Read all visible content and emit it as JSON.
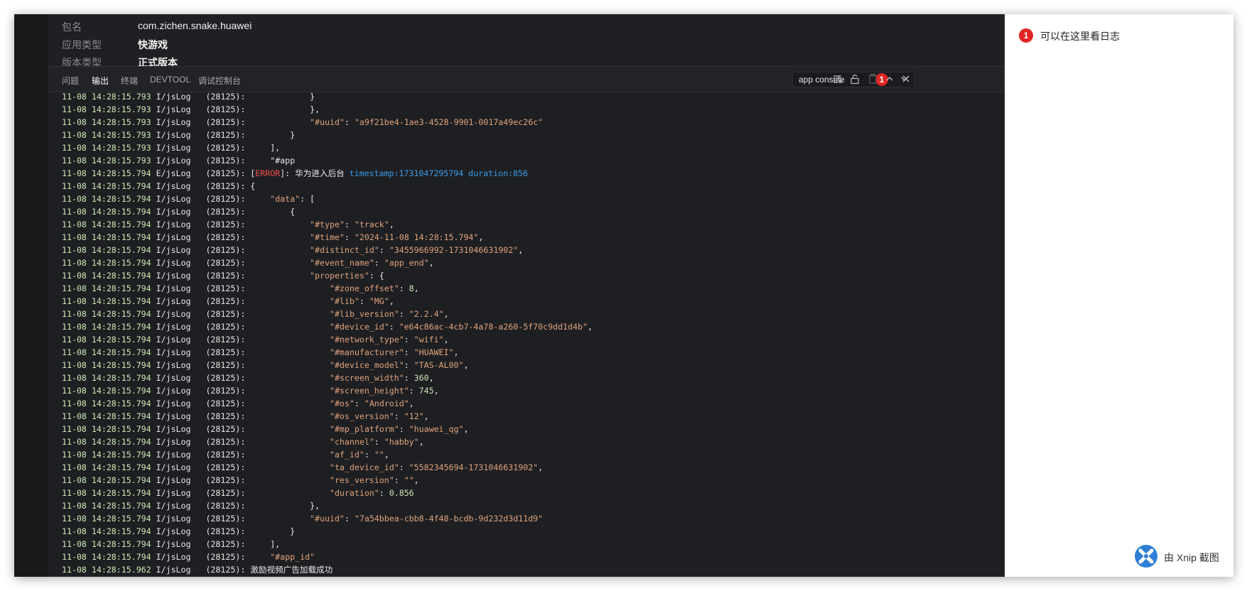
{
  "app_info": {
    "rows": [
      {
        "label": "包名",
        "value": "com.zichen.snake.huawei",
        "bold": false
      },
      {
        "label": "应用类型",
        "value": "快游戏",
        "bold": true
      },
      {
        "label": "版本类型",
        "value": "正式版本",
        "bold": true
      }
    ]
  },
  "panel": {
    "tabs": [
      {
        "label": "问题",
        "active": false
      },
      {
        "label": "输出",
        "active": true
      },
      {
        "label": "终端",
        "active": false
      },
      {
        "label": "DEVTOOL",
        "active": false
      },
      {
        "label": "调试控制台",
        "active": false
      }
    ],
    "filter": {
      "value": "app console",
      "badge": "1"
    },
    "icons": [
      "chevron-down-icon",
      "clear-output-icon",
      "lock-icon",
      "copy-icon",
      "chevron-up-icon",
      "close-icon"
    ]
  },
  "log": {
    "lines": [
      {
        "ts": "11-08 14:28:15.793",
        "tag": "I/jsLog",
        "pid": "(28125):",
        "indent": 0,
        "segs": [
          [
            "p",
            "            }"
          ]
        ]
      },
      {
        "ts": "11-08 14:28:15.793",
        "tag": "I/jsLog",
        "pid": "(28125):",
        "indent": 0,
        "segs": [
          [
            "p",
            "            },"
          ]
        ]
      },
      {
        "ts": "11-08 14:28:15.793",
        "tag": "I/jsLog",
        "pid": "(28125):",
        "indent": 0,
        "segs": [
          [
            "p",
            "            "
          ],
          [
            "k",
            "\"#uuid\""
          ],
          [
            "p",
            ": "
          ],
          [
            "s",
            "\"a9f21be4-1ae3-4528-9901-0017a49ec26c\""
          ]
        ]
      },
      {
        "ts": "11-08 14:28:15.793",
        "tag": "I/jsLog",
        "pid": "(28125):",
        "indent": 0,
        "segs": [
          [
            "p",
            "        }"
          ]
        ]
      },
      {
        "ts": "11-08 14:28:15.793",
        "tag": "I/jsLog",
        "pid": "(28125):",
        "indent": 0,
        "segs": [
          [
            "p",
            "    ],"
          ]
        ]
      },
      {
        "ts": "11-08 14:28:15.793",
        "tag": "I/jsLog",
        "pid": "(28125):",
        "indent": 0,
        "segs": [
          [
            "p",
            "    \"#app"
          ]
        ]
      },
      {
        "ts": "11-08 14:28:15.794",
        "tag": "E/jsLog",
        "pid": "(28125):",
        "indent": 0,
        "segs": [
          [
            "p",
            "["
          ],
          [
            "err",
            "ERROR"
          ],
          [
            "p",
            "]: 华为进入后台 "
          ],
          [
            "meta",
            "timestamp:1731047295794 duration:856"
          ]
        ]
      },
      {
        "ts": "11-08 14:28:15.794",
        "tag": "I/jsLog",
        "pid": "(28125):",
        "indent": 0,
        "segs": [
          [
            "p",
            "{"
          ]
        ]
      },
      {
        "ts": "11-08 14:28:15.794",
        "tag": "I/jsLog",
        "pid": "(28125):",
        "indent": 0,
        "segs": [
          [
            "p",
            "    "
          ],
          [
            "k",
            "\"data\""
          ],
          [
            "p",
            ": ["
          ]
        ]
      },
      {
        "ts": "11-08 14:28:15.794",
        "tag": "I/jsLog",
        "pid": "(28125):",
        "indent": 0,
        "segs": [
          [
            "p",
            "        {"
          ]
        ]
      },
      {
        "ts": "11-08 14:28:15.794",
        "tag": "I/jsLog",
        "pid": "(28125):",
        "indent": 0,
        "segs": [
          [
            "p",
            "            "
          ],
          [
            "k",
            "\"#type\""
          ],
          [
            "p",
            ": "
          ],
          [
            "s",
            "\"track\""
          ],
          [
            "p",
            ","
          ]
        ]
      },
      {
        "ts": "11-08 14:28:15.794",
        "tag": "I/jsLog",
        "pid": "(28125):",
        "indent": 0,
        "segs": [
          [
            "p",
            "            "
          ],
          [
            "k",
            "\"#time\""
          ],
          [
            "p",
            ": "
          ],
          [
            "s",
            "\"2024-11-08 14:28:15.794\""
          ],
          [
            "p",
            ","
          ]
        ]
      },
      {
        "ts": "11-08 14:28:15.794",
        "tag": "I/jsLog",
        "pid": "(28125):",
        "indent": 0,
        "segs": [
          [
            "p",
            "            "
          ],
          [
            "k",
            "\"#distinct_id\""
          ],
          [
            "p",
            ": "
          ],
          [
            "s",
            "\"3455966992-1731046631902\""
          ],
          [
            "p",
            ","
          ]
        ]
      },
      {
        "ts": "11-08 14:28:15.794",
        "tag": "I/jsLog",
        "pid": "(28125):",
        "indent": 0,
        "segs": [
          [
            "p",
            "            "
          ],
          [
            "k",
            "\"#event_name\""
          ],
          [
            "p",
            ": "
          ],
          [
            "s",
            "\"app_end\""
          ],
          [
            "p",
            ","
          ]
        ]
      },
      {
        "ts": "11-08 14:28:15.794",
        "tag": "I/jsLog",
        "pid": "(28125):",
        "indent": 0,
        "segs": [
          [
            "p",
            "            "
          ],
          [
            "k",
            "\"properties\""
          ],
          [
            "p",
            ": {"
          ]
        ]
      },
      {
        "ts": "11-08 14:28:15.794",
        "tag": "I/jsLog",
        "pid": "(28125):",
        "indent": 0,
        "segs": [
          [
            "p",
            "                "
          ],
          [
            "k",
            "\"#zone_offset\""
          ],
          [
            "p",
            ": "
          ],
          [
            "n",
            "8"
          ],
          [
            "p",
            ","
          ]
        ]
      },
      {
        "ts": "11-08 14:28:15.794",
        "tag": "I/jsLog",
        "pid": "(28125):",
        "indent": 0,
        "segs": [
          [
            "p",
            "                "
          ],
          [
            "k",
            "\"#lib\""
          ],
          [
            "p",
            ": "
          ],
          [
            "s",
            "\"MG\""
          ],
          [
            "p",
            ","
          ]
        ]
      },
      {
        "ts": "11-08 14:28:15.794",
        "tag": "I/jsLog",
        "pid": "(28125):",
        "indent": 0,
        "segs": [
          [
            "p",
            "                "
          ],
          [
            "k",
            "\"#lib_version\""
          ],
          [
            "p",
            ": "
          ],
          [
            "s",
            "\"2.2.4\""
          ],
          [
            "p",
            ","
          ]
        ]
      },
      {
        "ts": "11-08 14:28:15.794",
        "tag": "I/jsLog",
        "pid": "(28125):",
        "indent": 0,
        "segs": [
          [
            "p",
            "                "
          ],
          [
            "k",
            "\"#device_id\""
          ],
          [
            "p",
            ": "
          ],
          [
            "s",
            "\"e64c86ac-4cb7-4a78-a260-5f70c9dd1d4b\""
          ],
          [
            "p",
            ","
          ]
        ]
      },
      {
        "ts": "11-08 14:28:15.794",
        "tag": "I/jsLog",
        "pid": "(28125):",
        "indent": 0,
        "segs": [
          [
            "p",
            "                "
          ],
          [
            "k",
            "\"#network_type\""
          ],
          [
            "p",
            ": "
          ],
          [
            "s",
            "\"wifi\""
          ],
          [
            "p",
            ","
          ]
        ]
      },
      {
        "ts": "11-08 14:28:15.794",
        "tag": "I/jsLog",
        "pid": "(28125):",
        "indent": 0,
        "segs": [
          [
            "p",
            "                "
          ],
          [
            "k",
            "\"#manufacturer\""
          ],
          [
            "p",
            ": "
          ],
          [
            "s",
            "\"HUAWEI\""
          ],
          [
            "p",
            ","
          ]
        ]
      },
      {
        "ts": "11-08 14:28:15.794",
        "tag": "I/jsLog",
        "pid": "(28125):",
        "indent": 0,
        "segs": [
          [
            "p",
            "                "
          ],
          [
            "k",
            "\"#device_model\""
          ],
          [
            "p",
            ": "
          ],
          [
            "s",
            "\"TAS-AL00\""
          ],
          [
            "p",
            ","
          ]
        ]
      },
      {
        "ts": "11-08 14:28:15.794",
        "tag": "I/jsLog",
        "pid": "(28125):",
        "indent": 0,
        "segs": [
          [
            "p",
            "                "
          ],
          [
            "k",
            "\"#screen_width\""
          ],
          [
            "p",
            ": "
          ],
          [
            "n",
            "360"
          ],
          [
            "p",
            ","
          ]
        ]
      },
      {
        "ts": "11-08 14:28:15.794",
        "tag": "I/jsLog",
        "pid": "(28125):",
        "indent": 0,
        "segs": [
          [
            "p",
            "                "
          ],
          [
            "k",
            "\"#screen_height\""
          ],
          [
            "p",
            ": "
          ],
          [
            "n",
            "745"
          ],
          [
            "p",
            ","
          ]
        ]
      },
      {
        "ts": "11-08 14:28:15.794",
        "tag": "I/jsLog",
        "pid": "(28125):",
        "indent": 0,
        "segs": [
          [
            "p",
            "                "
          ],
          [
            "k",
            "\"#os\""
          ],
          [
            "p",
            ": "
          ],
          [
            "s",
            "\"Android\""
          ],
          [
            "p",
            ","
          ]
        ]
      },
      {
        "ts": "11-08 14:28:15.794",
        "tag": "I/jsLog",
        "pid": "(28125):",
        "indent": 0,
        "segs": [
          [
            "p",
            "                "
          ],
          [
            "k",
            "\"#os_version\""
          ],
          [
            "p",
            ": "
          ],
          [
            "s",
            "\"12\""
          ],
          [
            "p",
            ","
          ]
        ]
      },
      {
        "ts": "11-08 14:28:15.794",
        "tag": "I/jsLog",
        "pid": "(28125):",
        "indent": 0,
        "segs": [
          [
            "p",
            "                "
          ],
          [
            "k",
            "\"#mp_platform\""
          ],
          [
            "p",
            ": "
          ],
          [
            "s",
            "\"huawei_qg\""
          ],
          [
            "p",
            ","
          ]
        ]
      },
      {
        "ts": "11-08 14:28:15.794",
        "tag": "I/jsLog",
        "pid": "(28125):",
        "indent": 0,
        "segs": [
          [
            "p",
            "                "
          ],
          [
            "k",
            "\"channel\""
          ],
          [
            "p",
            ": "
          ],
          [
            "s",
            "\"habby\""
          ],
          [
            "p",
            ","
          ]
        ]
      },
      {
        "ts": "11-08 14:28:15.794",
        "tag": "I/jsLog",
        "pid": "(28125):",
        "indent": 0,
        "segs": [
          [
            "p",
            "                "
          ],
          [
            "k",
            "\"af_id\""
          ],
          [
            "p",
            ": "
          ],
          [
            "s",
            "\"\""
          ],
          [
            "p",
            ","
          ]
        ]
      },
      {
        "ts": "11-08 14:28:15.794",
        "tag": "I/jsLog",
        "pid": "(28125):",
        "indent": 0,
        "segs": [
          [
            "p",
            "                "
          ],
          [
            "k",
            "\"ta_device_id\""
          ],
          [
            "p",
            ": "
          ],
          [
            "s",
            "\"5582345694-1731046631902\""
          ],
          [
            "p",
            ","
          ]
        ]
      },
      {
        "ts": "11-08 14:28:15.794",
        "tag": "I/jsLog",
        "pid": "(28125):",
        "indent": 0,
        "segs": [
          [
            "p",
            "                "
          ],
          [
            "k",
            "\"res_version\""
          ],
          [
            "p",
            ": "
          ],
          [
            "s",
            "\"\""
          ],
          [
            "p",
            ","
          ]
        ]
      },
      {
        "ts": "11-08 14:28:15.794",
        "tag": "I/jsLog",
        "pid": "(28125):",
        "indent": 0,
        "segs": [
          [
            "p",
            "                "
          ],
          [
            "k",
            "\"duration\""
          ],
          [
            "p",
            ": "
          ],
          [
            "n",
            "0.856"
          ]
        ]
      },
      {
        "ts": "11-08 14:28:15.794",
        "tag": "I/jsLog",
        "pid": "(28125):",
        "indent": 0,
        "segs": [
          [
            "p",
            "            },"
          ]
        ]
      },
      {
        "ts": "11-08 14:28:15.794",
        "tag": "I/jsLog",
        "pid": "(28125):",
        "indent": 0,
        "segs": [
          [
            "p",
            "            "
          ],
          [
            "k",
            "\"#uuid\""
          ],
          [
            "p",
            ": "
          ],
          [
            "s",
            "\"7a54bbea-cbb8-4f48-bcdb-9d232d3d11d9\""
          ]
        ]
      },
      {
        "ts": "11-08 14:28:15.794",
        "tag": "I/jsLog",
        "pid": "(28125):",
        "indent": 0,
        "segs": [
          [
            "p",
            "        }"
          ]
        ]
      },
      {
        "ts": "11-08 14:28:15.794",
        "tag": "I/jsLog",
        "pid": "(28125):",
        "indent": 0,
        "segs": [
          [
            "p",
            "    ],"
          ]
        ]
      },
      {
        "ts": "11-08 14:28:15.794",
        "tag": "I/jsLog",
        "pid": "(28125):",
        "indent": 0,
        "segs": [
          [
            "p",
            "    "
          ],
          [
            "k",
            "\"#app_id\""
          ]
        ]
      },
      {
        "ts": "11-08 14:28:15.962",
        "tag": "I/jsLog",
        "pid": "(28125):",
        "indent": 0,
        "segs": [
          [
            "p",
            "激励视频广告加载成功"
          ]
        ]
      }
    ]
  },
  "annotation": {
    "badge": "1",
    "text": "可以在这里看日志"
  },
  "watermark": {
    "text": "由 Xnip 截图",
    "icon": "xnip-logo-icon"
  },
  "colors": {
    "editor_bg": "#1e1f22",
    "badge_red": "#e02424",
    "timestamp_green": "#ccebb4",
    "string_orange": "#e0a37c",
    "error_red": "#f14c4c",
    "meta_blue": "#3a9be8"
  }
}
